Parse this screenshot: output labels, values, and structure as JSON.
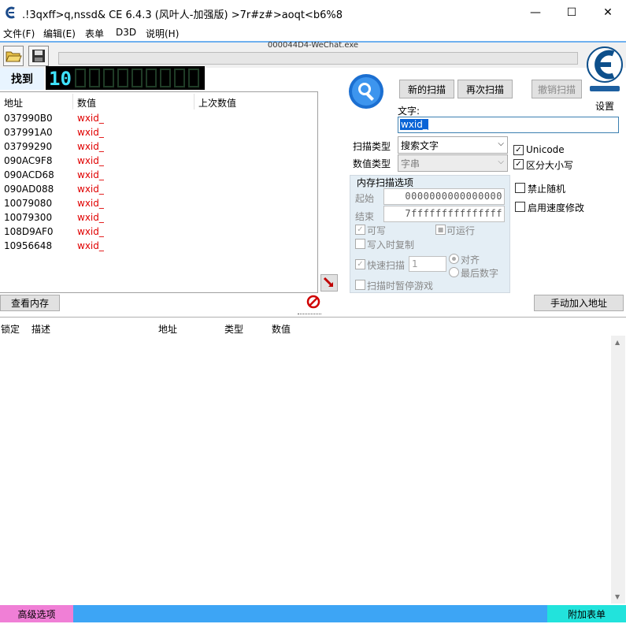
{
  "window": {
    "title": ".!3qxff>q,nssd&  CE 6.4.3 (风叶人-加强版)  >7r#z#>aoqt<b6%8",
    "minimize": "—",
    "maximize": "☐",
    "close": "✕"
  },
  "menu": [
    "文件(F)",
    "编辑(E)",
    "表单",
    "D3D",
    "说明(H)"
  ],
  "process": "000044D4-WeChat.exe",
  "found_label": "找到",
  "found_count": "10",
  "results": {
    "headers": [
      "地址",
      "数值",
      "上次数值"
    ],
    "rows": [
      {
        "addr": "037990B0",
        "val": "wxid_"
      },
      {
        "addr": "037991A0",
        "val": "wxid_"
      },
      {
        "addr": "03799290",
        "val": "wxid_"
      },
      {
        "addr": "090AC9F8",
        "val": "wxid_"
      },
      {
        "addr": "090ACD68",
        "val": "wxid_"
      },
      {
        "addr": "090AD088",
        "val": "wxid_"
      },
      {
        "addr": "10079080",
        "val": "wxid_"
      },
      {
        "addr": "10079300",
        "val": "wxid_"
      },
      {
        "addr": "108D9AF0",
        "val": "wxid_"
      },
      {
        "addr": "10956648",
        "val": "wxid_"
      }
    ]
  },
  "scan": {
    "new_scan": "新的扫描",
    "next_scan": "再次扫描",
    "undo_scan": "撤销扫描",
    "settings": "设置",
    "text_label": "文字:",
    "text_value": "wxid_",
    "scan_type_label": "扫描类型",
    "scan_type_value": "搜索文字",
    "value_type_label": "数值类型",
    "value_type_value": "字串",
    "unicode": "Unicode",
    "case_sensitive": "区分大小写",
    "disable_random": "禁止随机",
    "speed_hack": "启用速度修改"
  },
  "mem": {
    "title": "内存扫描选项",
    "start_label": "起始",
    "start_value": "0000000000000000",
    "end_label": "结束",
    "end_value": "7fffffffffffffff",
    "writable": "可写",
    "executable": "可运行",
    "copy_on_write": "写入时复制",
    "fast_scan": "快速扫描",
    "fast_value": "1",
    "align": "对齐",
    "last_digits": "最后数字",
    "pause_game": "扫描时暂停游戏"
  },
  "view_memory": "查看内存",
  "add_address": "手动加入地址",
  "table_headers": [
    "锁定",
    "描述",
    "地址",
    "类型",
    "数值"
  ],
  "status": {
    "advanced": "高级选项",
    "extra": "附加表单"
  },
  "colors": {
    "accent_blue": "#3da5f5",
    "value_red": "#e00000",
    "pink": "#f07fd6",
    "cyan": "#22e3dc"
  }
}
